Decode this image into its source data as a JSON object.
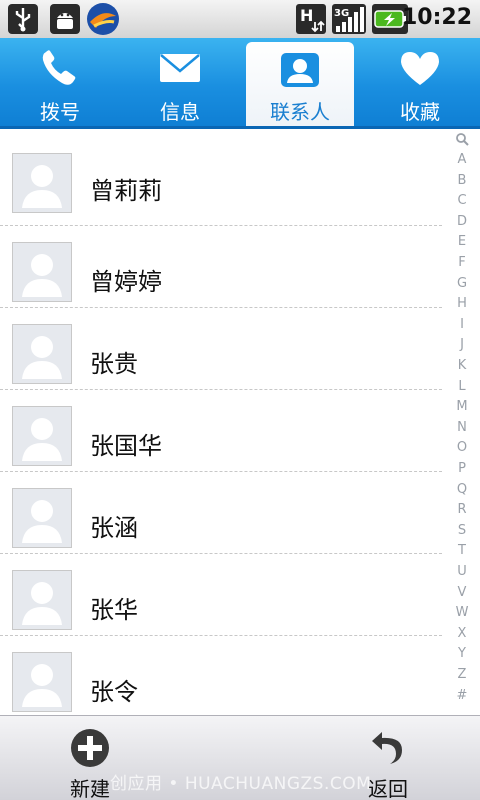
{
  "status_bar": {
    "time": "10:22",
    "icons": [
      "usb-icon",
      "android-debug-icon",
      "app-notification-icon",
      "h-data-icon",
      "3g-signal-icon",
      "battery-charging-icon"
    ],
    "network_type": "H",
    "signal_type": "3G"
  },
  "tabs": [
    {
      "label": "拨号",
      "icon": "phone-icon",
      "active": false
    },
    {
      "label": "信息",
      "icon": "envelope-icon",
      "active": false
    },
    {
      "label": "联系人",
      "icon": "contact-icon",
      "active": true
    },
    {
      "label": "收藏",
      "icon": "heart-icon",
      "active": false
    }
  ],
  "contacts": [
    {
      "name": "曾莉莉"
    },
    {
      "name": "曾婷婷"
    },
    {
      "name": "张贵"
    },
    {
      "name": "张国华"
    },
    {
      "name": "张涵"
    },
    {
      "name": "张华"
    },
    {
      "name": "张令"
    }
  ],
  "alpha_index": [
    "A",
    "B",
    "C",
    "D",
    "E",
    "F",
    "G",
    "H",
    "I",
    "J",
    "K",
    "L",
    "M",
    "N",
    "O",
    "P",
    "Q",
    "R",
    "S",
    "T",
    "U",
    "V",
    "W",
    "X",
    "Y",
    "Z",
    "#"
  ],
  "bottom_bar": {
    "new_label": "新建",
    "back_label": "返回"
  },
  "watermark": "创应用 • HUACHUANGZS.COM",
  "colors": {
    "tab_bar": "#1a8fe0",
    "active_tab_text": "#1a7fd0",
    "index_letters": "#9aa0a8"
  }
}
